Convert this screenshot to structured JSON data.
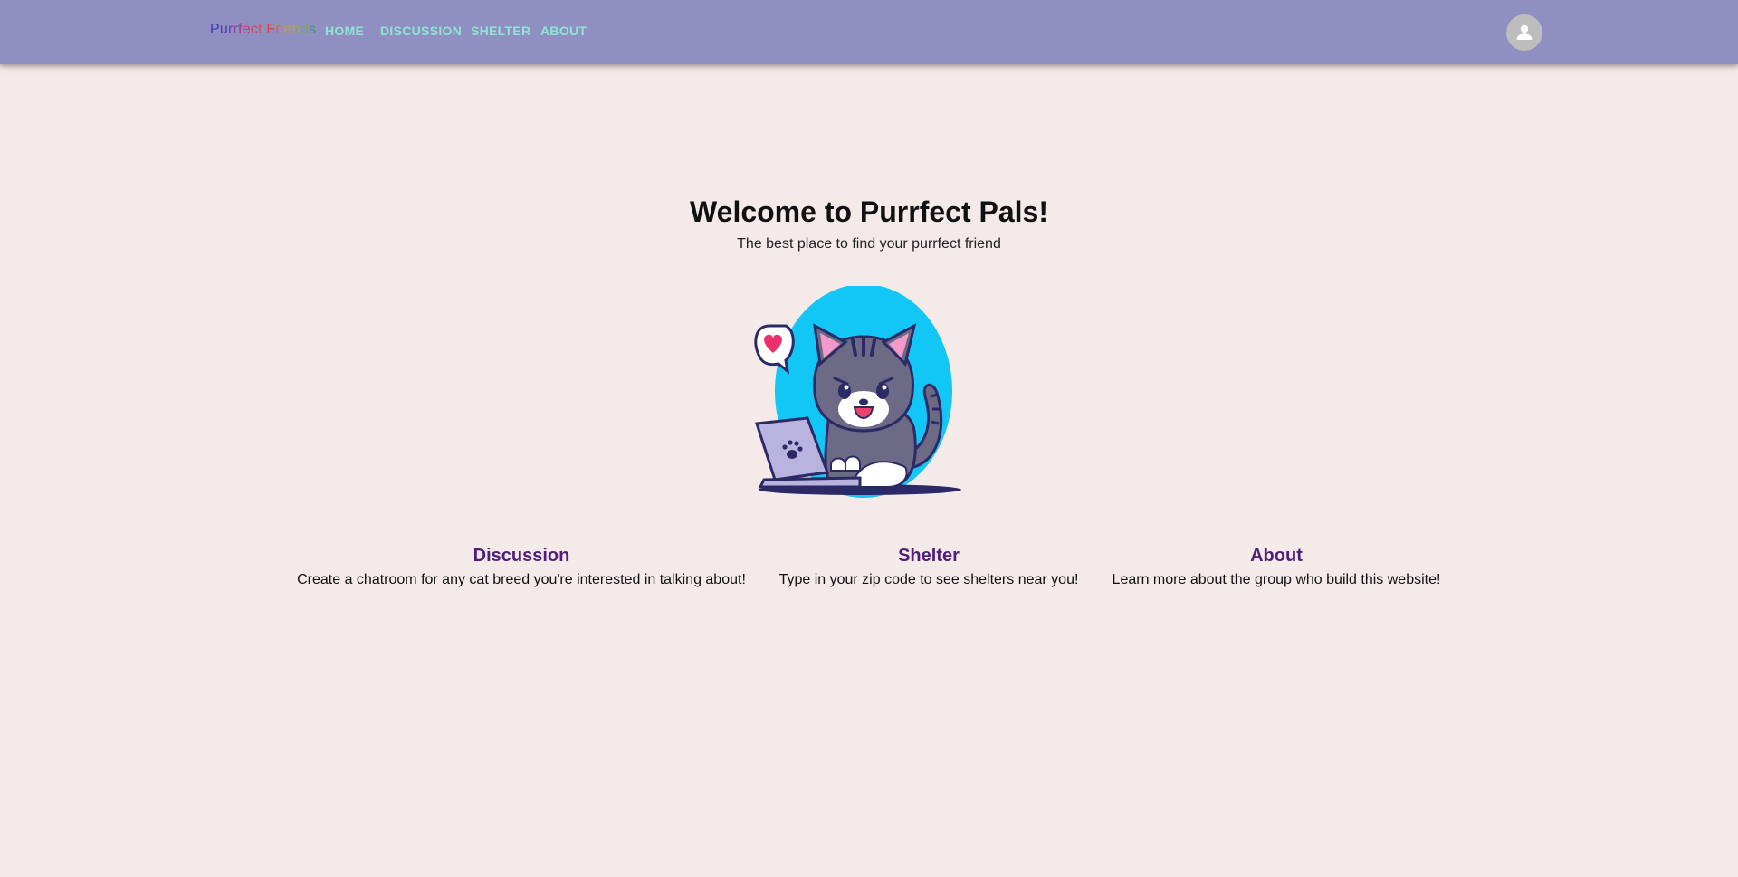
{
  "navbar": {
    "brand_letters": [
      {
        "ch": "P",
        "color": "#3b3bb3"
      },
      {
        "ch": "u",
        "color": "#4d3ab8"
      },
      {
        "ch": "r",
        "color": "#6a3aa8"
      },
      {
        "ch": "r",
        "color": "#8a3a9e"
      },
      {
        "ch": "f",
        "color": "#a43a8e"
      },
      {
        "ch": "e",
        "color": "#c23a6e"
      },
      {
        "ch": "c",
        "color": "#d4455a"
      },
      {
        "ch": "t",
        "color": "#d9534a"
      },
      {
        "ch": " ",
        "color": "#d9534a"
      },
      {
        "ch": "F",
        "color": "#e04438"
      },
      {
        "ch": "r",
        "color": "#e2603a"
      },
      {
        "ch": "i",
        "color": "#d8853e"
      },
      {
        "ch": "e",
        "color": "#c69a44"
      },
      {
        "ch": "n",
        "color": "#a9a84c"
      },
      {
        "ch": "d",
        "color": "#7fa55a"
      },
      {
        "ch": "s",
        "color": "#3d9a6a"
      }
    ],
    "links": {
      "home": "HOME",
      "discussion": "DISCUSSION",
      "shelter": "SHELTER",
      "about": "ABOUT"
    },
    "link_color": "#8ce6d3",
    "background": "#8f8fc2",
    "avatar_icon": "account-icon"
  },
  "hero": {
    "title": "Welcome to Purrfect Pals!",
    "subtitle": "The best place to find your purrfect friend",
    "illustration": "cat-with-laptop-illustration"
  },
  "features": {
    "discussion": {
      "title": "Discussion",
      "description": "Create a chatroom for any cat breed you're interested in talking about!"
    },
    "shelter": {
      "title": "Shelter",
      "description": "Type in your zip code to see shelters near you!"
    },
    "about": {
      "title": "About",
      "description": "Learn more about the group who build this website!"
    }
  },
  "colors": {
    "page_background": "#f4eae8",
    "feature_title": "#4e1e7a"
  }
}
